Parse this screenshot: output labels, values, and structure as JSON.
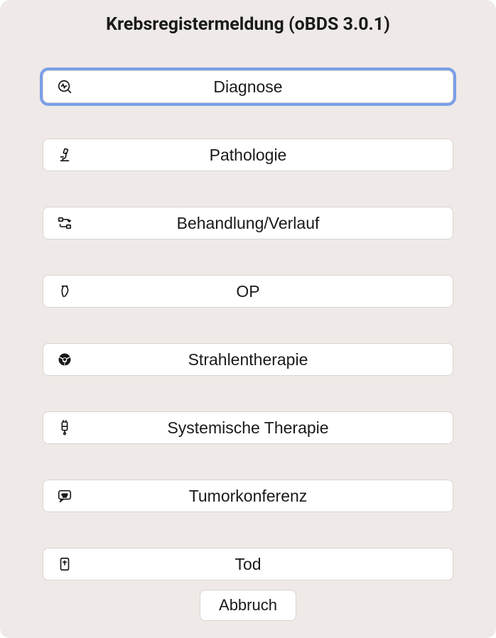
{
  "title": "Krebsregistermeldung (oBDS 3.0.1)",
  "options": [
    {
      "label": "Diagnose",
      "icon": "diagnose",
      "selected": true
    },
    {
      "label": "Pathologie",
      "icon": "microscope",
      "selected": false
    },
    {
      "label": "Behandlung/Verlauf",
      "icon": "flow",
      "selected": false
    },
    {
      "label": "OP",
      "icon": "scalpel",
      "selected": false
    },
    {
      "label": "Strahlentherapie",
      "icon": "radiation",
      "selected": false
    },
    {
      "label": "Systemische Therapie",
      "icon": "iv",
      "selected": false
    },
    {
      "label": "Tumorkonferenz",
      "icon": "conference",
      "selected": false
    },
    {
      "label": "Tod",
      "icon": "death",
      "selected": false
    }
  ],
  "footer": {
    "cancel": "Abbruch"
  }
}
